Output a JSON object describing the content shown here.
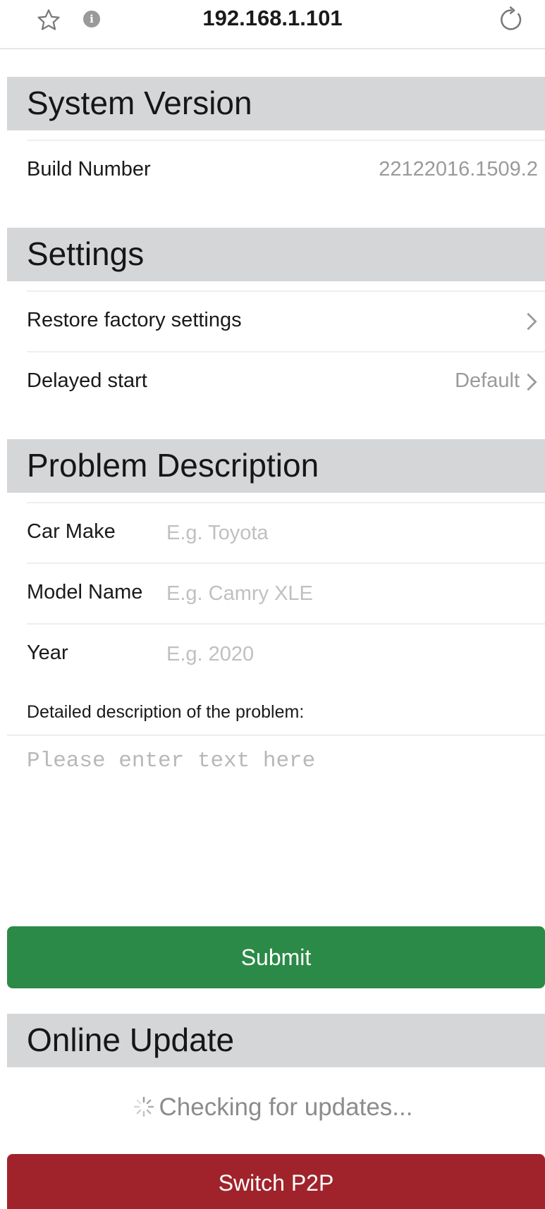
{
  "browser": {
    "address": "192.168.1.101",
    "star_icon": "star-icon",
    "info_icon": "info-icon",
    "reload_icon": "reload-icon"
  },
  "system_version": {
    "title": "System Version",
    "build_label": "Build Number",
    "build_value": "22122016.1509.2"
  },
  "settings": {
    "title": "Settings",
    "restore_label": "Restore factory settings",
    "delayed_label": "Delayed start",
    "delayed_value": "Default"
  },
  "problem": {
    "title": "Problem Description",
    "fields": [
      {
        "label": "Car Make",
        "placeholder": "E.g. Toyota",
        "value": ""
      },
      {
        "label": "Model Name",
        "placeholder": "E.g. Camry XLE",
        "value": ""
      },
      {
        "label": "Year",
        "placeholder": "E.g. 2020",
        "value": ""
      }
    ],
    "description_label": "Detailed description of the problem:",
    "description_placeholder": "Please enter text here",
    "submit_label": "Submit"
  },
  "online_update": {
    "title": "Online Update",
    "status": "Checking for updates...",
    "p2p_label": "Switch P2P"
  },
  "colors": {
    "submit": "#2b8a47",
    "p2p": "#a0232b",
    "section_bg": "#d5d6d8"
  }
}
